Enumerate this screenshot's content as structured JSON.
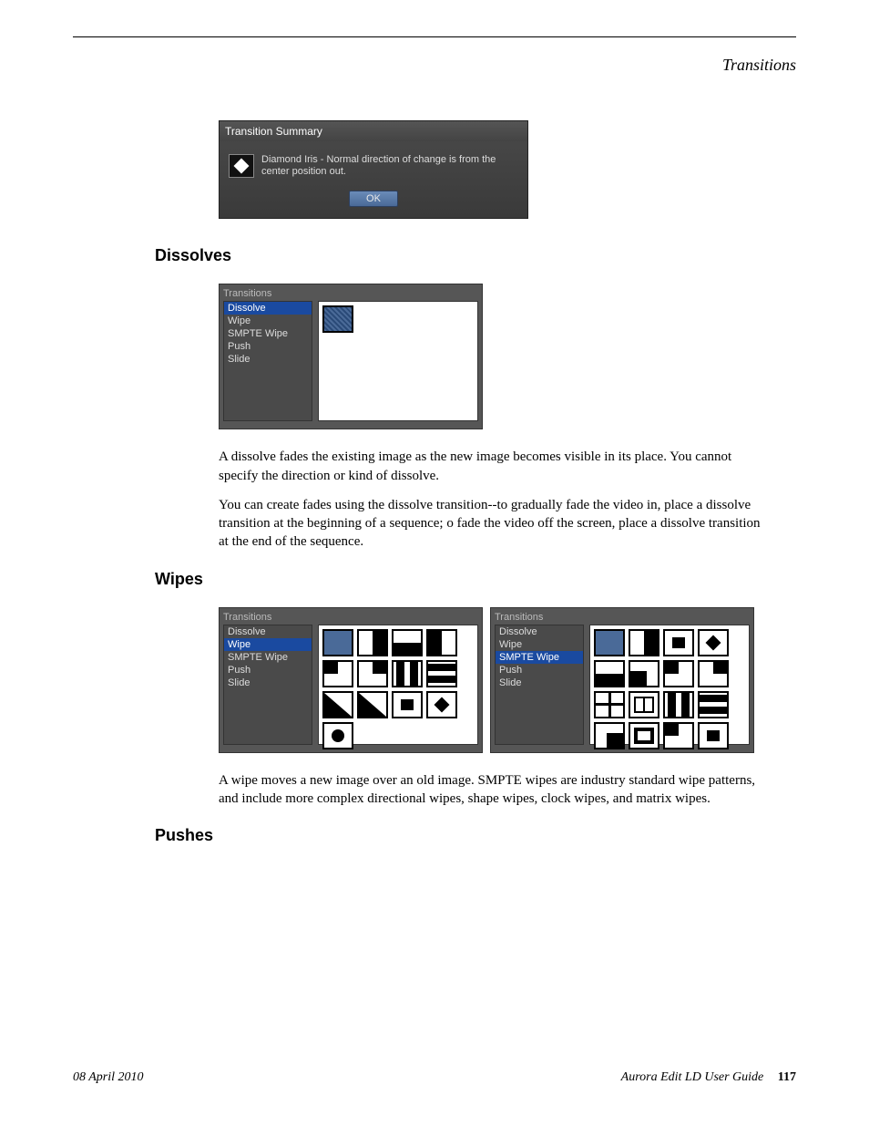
{
  "header": {
    "title": "Transitions"
  },
  "dialog": {
    "title": "Transition Summary",
    "icon": "diamond-iris-icon",
    "description": "Diamond Iris - Normal direction of change is from the center position out.",
    "ok_label": "OK"
  },
  "sections": {
    "dissolves": {
      "heading": "Dissolves",
      "para1": "A dissolve fades the existing image as the new image becomes visible in its place. You cannot specify the direction or kind of dissolve.",
      "para2": "You can create fades using the dissolve transition--to gradually fade the video in, place a dissolve transition at the beginning of a sequence; o fade the video off the screen, place a dissolve transition at the end of the sequence."
    },
    "wipes": {
      "heading": "Wipes",
      "para1": "A wipe moves a new image over an old image. SMPTE wipes are industry standard wipe patterns, and include more complex directional wipes, shape wipes, clock wipes, and matrix wipes."
    },
    "pushes": {
      "heading": "Pushes"
    }
  },
  "transitions_list": {
    "label": "Transitions",
    "items": [
      "Dissolve",
      "Wipe",
      "SMPTE Wipe",
      "Push",
      "Slide"
    ]
  },
  "panels": {
    "dissolve_selected": "Dissolve",
    "wipe_selected": "Wipe",
    "smpte_selected": "SMPTE Wipe"
  },
  "footer": {
    "date": "08 April 2010",
    "guide": "Aurora Edit LD User Guide",
    "page": "117"
  }
}
